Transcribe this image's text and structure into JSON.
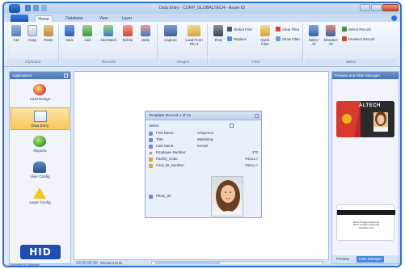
{
  "window": {
    "title": "Data Entry - CORP_GLOBALTECH - Asure ID"
  },
  "tabs": [
    "Home",
    "Database",
    "View",
    "Layer"
  ],
  "ribbon": {
    "clipboard": {
      "label": "Clipboard",
      "buttons": [
        "Cut",
        "Copy",
        "Paste"
      ]
    },
    "records": {
      "label": "Records",
      "buttons": [
        "Save",
        "Add",
        "Add Batch",
        "Delete",
        "Undo"
      ]
    },
    "images": {
      "label": "Images",
      "buttons": [
        "Capture",
        "Load From File ▾"
      ]
    },
    "find": {
      "label": "Find",
      "buttons": [
        "Find",
        "Quick Filter"
      ],
      "small": [
        "Global Find",
        "Replace",
        "Clear Filter",
        "Show Filter"
      ]
    },
    "select": {
      "label": "Select",
      "buttons": [
        "Select All",
        "Deselect All"
      ],
      "small": [
        "Select Record",
        "Deselect Record"
      ]
    }
  },
  "apps": {
    "title": "Applications",
    "items": [
      "Card Design",
      "Data Entry",
      "Reports",
      "User Config",
      "Layer Config"
    ],
    "logo": "HID"
  },
  "template": {
    "title": "Template Record 4 of 31",
    "fields": [
      {
        "label": "Select:",
        "value": ""
      },
      {
        "label": "First Name:",
        "value": "Cheyenne"
      },
      {
        "label": "Title:",
        "value": "Marketing"
      },
      {
        "label": "Last Name:",
        "value": "Kessel"
      },
      {
        "label": "Employee Number:",
        "value": "473"
      },
      {
        "label": "Facility_Code:",
        "value": "<NULL>"
      },
      {
        "label": "Card_ID_Number:",
        "value": "<NULL>"
      },
      {
        "label": "Photo_ID:",
        "value": ""
      }
    ]
  },
  "navbar": {
    "record_text": "Record 4 of 31"
  },
  "preview": {
    "title": "Preview and Filter Manager",
    "card_brand": "ALTECH",
    "back_text": [
      "Return Postage Guaranteed",
      "Return Postage Guaranteed",
      "Globaltech Corp"
    ],
    "tabs": [
      "Preview",
      "Filter Manager"
    ]
  },
  "statusbar": {
    "text": "Connected to Database"
  },
  "colors": {
    "accent": "#2a6fd6",
    "active_app": "#f9c65a",
    "hid_blue": "#1e4fb0"
  }
}
